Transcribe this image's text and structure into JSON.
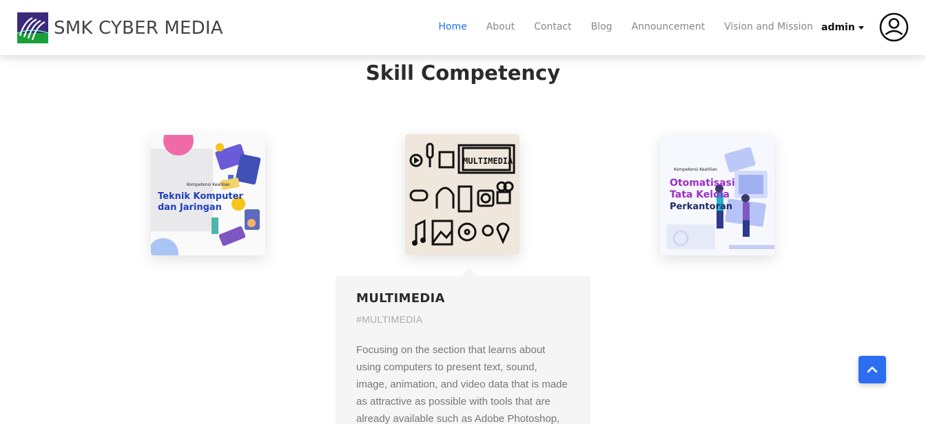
{
  "brand": {
    "name": "SMK CYBER MEDIA",
    "logo_icon": "school-logo-icon"
  },
  "nav": {
    "items": [
      {
        "label": "Home",
        "active": true
      },
      {
        "label": "About",
        "active": false
      },
      {
        "label": "Contact",
        "active": false
      },
      {
        "label": "Blog",
        "active": false
      },
      {
        "label": "Announcement",
        "active": false
      },
      {
        "label": "Vision and Mission",
        "active": false
      }
    ],
    "user_label": "admin",
    "avatar_icon": "user-circle-icon",
    "active_color": "#1f6ff0"
  },
  "section": {
    "title": "Skill Competency"
  },
  "cards": [
    {
      "subtitle": "Kompetensi Keahlian",
      "title_line1": "Teknik Komputer",
      "title_line2": "dan Jaringan",
      "image": "tkj-illustration"
    },
    {
      "title": "MULTIMEDIA",
      "image": "multimedia-icons-illustration"
    },
    {
      "subtitle": "Kompetensi Keahlian",
      "title_line1": "Otomatisasi",
      "title_line2": "Tata Kelola",
      "title_line3": "Perkantoran",
      "image": "otkp-illustration"
    }
  ],
  "detail": {
    "title": "MULTIMEDIA",
    "tag": "#MULTIMEDIA",
    "body": "Focusing on the section that learns about using computers to present text, sound, image, animation, and video data that is made as attractive as possible with tools that are already available such as Adobe Photoshop, CorelDraw,"
  },
  "back_to_top": {
    "icon": "chevron-up-icon",
    "color": "#2d6ef0"
  }
}
